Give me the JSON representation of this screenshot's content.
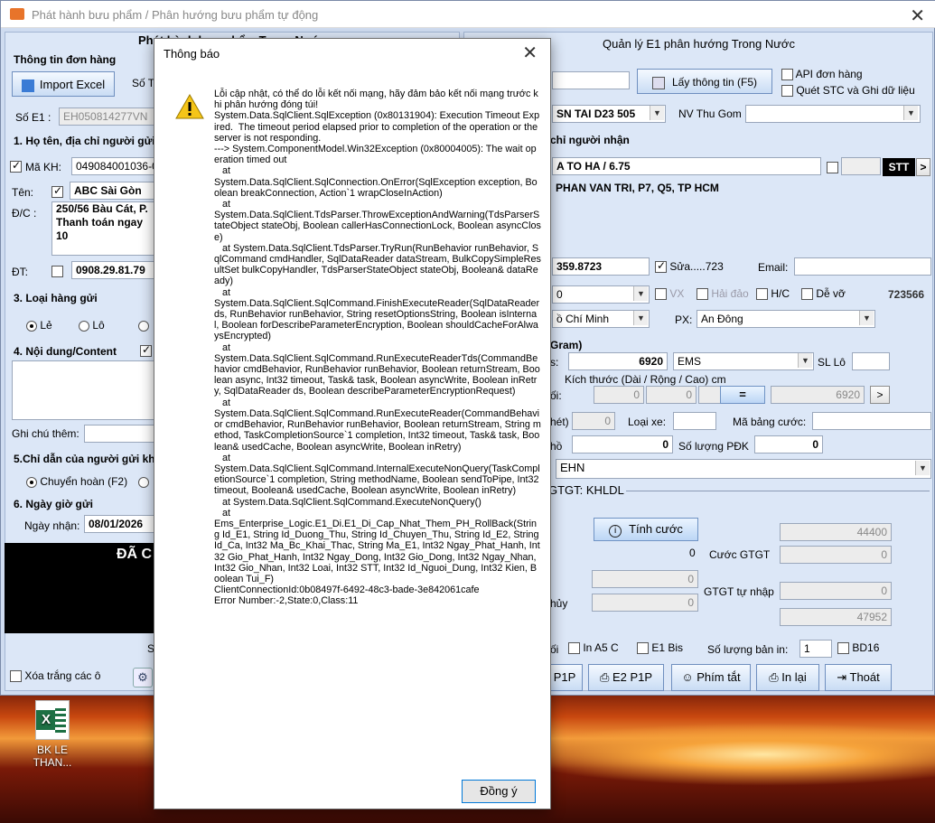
{
  "window": {
    "title": "Phát hành bưu phẩm / Phân hướng bưu phẩm tự động",
    "close": "✕"
  },
  "left": {
    "header_partial": "Phát hành bưu phẩm Trong Nước",
    "order_info": "Thông tin đơn hàng",
    "import_excel": "Import Excel",
    "so_t": "Số T",
    "so_e1_label": "Số E1 :",
    "so_e1_value": "EH050814277VN",
    "sec1": "1. Họ tên, địa chỉ người gửi",
    "ma_kh_label": "Mã KH:",
    "ma_kh_value": "049084001036-0",
    "ten_label": "Tên:",
    "ten_value": "ABC Sài Gòn",
    "dc_label": "Đ/C :",
    "dc_value": "250/56 Bàu Cát, P.\nThanh toán ngay 10",
    "dt_label": "ĐT:",
    "dt_value": "0908.29.81.79",
    "sec3": "3. Loại hàng gửi",
    "le": "Lẻ",
    "lo": "Lô",
    "sec4": "4. Nội dung/Content",
    "ghichu": "Ghi chú thêm:",
    "sec5": "5.Chỉ dẫn của người gửi khi",
    "chuyenhoan": "Chuyển hoàn (F2)",
    "sec6": "6. Ngày giờ gửi",
    "ngaynhan_label": "Ngày nhận:",
    "ngaynhan_value": "08/01/2026",
    "black_text": "ĐÃ C",
    "s_text": "S",
    "xoatrang": "Xóa trắng các ô"
  },
  "right": {
    "title": "Quản lý E1 phân hướng Trong Nước",
    "laythongtin": "Lấy thông tin (F5)",
    "api": "API đơn hàng",
    "quet": "Quét STC và Ghi dữ liệu",
    "station": "SN TAI D23 505",
    "nvthugom": "NV Thu Gom",
    "nguoinhan_hdr": "chỉ người nhận",
    "recv_name": "A TO HA / 6.75",
    "stt": "STT",
    "recv_addr": "PHAN VAN TRI, P7, Q5, TP HCM",
    "recv_phone": "359.8723",
    "sua": "Sửa.....723",
    "email": "Email:",
    "zero": "0",
    "vx": "VX",
    "haidao": "Hải đảo",
    "hc": "H/C",
    "devo": "Dễ vỡ",
    "code": "723566",
    "tinh": "ồ Chí Minh",
    "px": "PX:",
    "px_value": "An Đông",
    "gram": "Gram)",
    "weight": "6920",
    "service": "EMS",
    "sllo": "SL Lô",
    "kichthuoc": "Kích thước (Dài / Rộng / Cao) cm",
    "dims": [
      "0",
      "0",
      "0"
    ],
    "eq": "=",
    "calc_w": "6920",
    "next": ">",
    "loaixe": "Loại xe:",
    "mabangcuoc": "Mã bảng cước:",
    "slpdk": "Số lượng PĐK",
    "slpdk_value": "0",
    "v0a": "0",
    "v0b": "0",
    "ehn": "EHN",
    "gtgt": "GTGT: KHLDL",
    "tinhcuoc": "Tính cước",
    "cuoc_total": "44400",
    "cuocgtgt": "Cước GTGT",
    "cuocgtgt_value": "0",
    "zero_left": "0",
    "f1": "0",
    "f2": "0",
    "gtgttunhap": "GTGT tự nhập",
    "gtgttunhap_value": "0",
    "total": "47952",
    "lbl_noi": "ối",
    "lbl_huy": "hủy",
    "lbl_net": "hét)",
    "lbl_ho": "hồ",
    "lbl_s": "s:",
    "lbl_oi": "ối:",
    "ina5c": "In A5 C",
    "e1bis": "E1 Bis",
    "soluongbanin": "Số lượng bản in:",
    "soluong_value": "1",
    "bd16": "BD16",
    "p1p": "P1P",
    "e2p1p": "E2 P1P",
    "phimtat": "Phím tắt",
    "inlai": "In lại",
    "thoat": "Thoát"
  },
  "desktop": {
    "icon_label": "BK LE\nTHAN..."
  },
  "dialog": {
    "title": "Thông báo",
    "close": "✕",
    "message": "Lỗi cập nhật, có thể do lỗi kết nối mạng, hãy đảm bảo kết nối mạng trước khi phân hướng đóng túi!\nSystem.Data.SqlClient.SqlException (0x80131904): Execution Timeout Expired.  The timeout period elapsed prior to completion of the operation or the server is not responding.\n---> System.ComponentModel.Win32Exception (0x80004005): The wait operation timed out\n   at\nSystem.Data.SqlClient.SqlConnection.OnError(SqlException exception, Boolean breakConnection, Action`1 wrapCloseInAction)\n   at\nSystem.Data.SqlClient.TdsParser.ThrowExceptionAndWarning(TdsParserStateObject stateObj, Boolean callerHasConnectionLock, Boolean asyncClose)\n   at System.Data.SqlClient.TdsParser.TryRun(RunBehavior runBehavior, SqlCommand cmdHandler, SqlDataReader dataStream, BulkCopySimpleResultSet bulkCopyHandler, TdsParserStateObject stateObj, Boolean& dataReady)\n   at\nSystem.Data.SqlClient.SqlCommand.FinishExecuteReader(SqlDataReader ds, RunBehavior runBehavior, String resetOptionsString, Boolean isInternal, Boolean forDescribeParameterEncryption, Boolean shouldCacheForAlwaysEncrypted)\n   at\nSystem.Data.SqlClient.SqlCommand.RunExecuteReaderTds(CommandBehavior cmdBehavior, RunBehavior runBehavior, Boolean returnStream, Boolean async, Int32 timeout, Task& task, Boolean asyncWrite, Boolean inRetry, SqlDataReader ds, Boolean describeParameterEncryptionRequest)\n   at\nSystem.Data.SqlClient.SqlCommand.RunExecuteReader(CommandBehavior cmdBehavior, RunBehavior runBehavior, Boolean returnStream, String method, TaskCompletionSource`1 completion, Int32 timeout, Task& task, Boolean& usedCache, Boolean asyncWrite, Boolean inRetry)\n   at\nSystem.Data.SqlClient.SqlCommand.InternalExecuteNonQuery(TaskCompletionSource`1 completion, String methodName, Boolean sendToPipe, Int32 timeout, Boolean& usedCache, Boolean asyncWrite, Boolean inRetry)\n   at System.Data.SqlClient.SqlCommand.ExecuteNonQuery()\n   at\nEms_Enterprise_Logic.E1_Di.E1_Di_Cap_Nhat_Them_PH_RollBack(String Id_E1, String Id_Duong_Thu, String Id_Chuyen_Thu, String Id_E2, String Id_Ca, Int32 Ma_Bc_Khai_Thac, String Ma_E1, Int32 Ngay_Phat_Hanh, Int32 Gio_Phat_Hanh, Int32 Ngay_Dong, Int32 Gio_Dong, Int32 Ngay_Nhan, Int32 Gio_Nhan, Int32 Loai, Int32 STT, Int32 Id_Nguoi_Dung, Int32 Kien, Boolean Tui_F)\nClientConnectionId:0b08497f-6492-48c3-bade-3e842061cafe\nError Number:-2,State:0,Class:11",
    "ok": "Đồng ý"
  }
}
